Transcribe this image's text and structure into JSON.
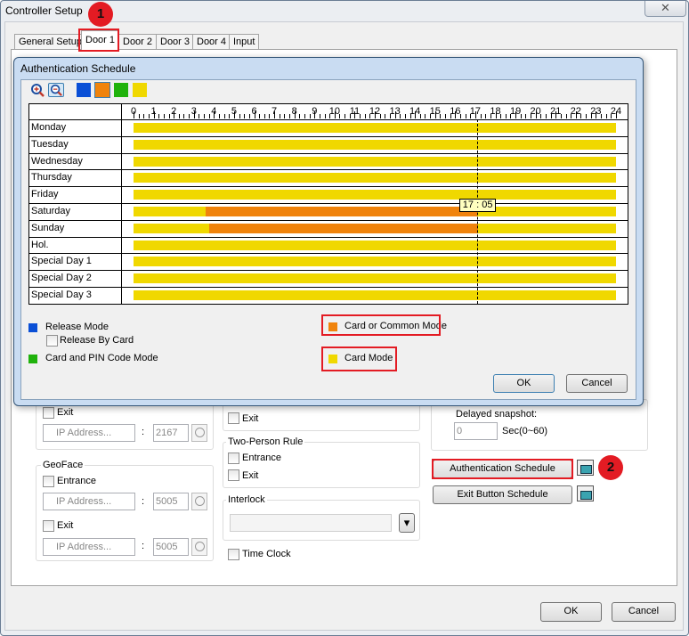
{
  "window": {
    "title": "Controller Setup",
    "close": "✕"
  },
  "tabs": [
    "General Setup",
    "Door 1",
    "Door 2",
    "Door 3",
    "Door 4",
    "Input"
  ],
  "annotations": {
    "badge1": "1",
    "badge2": "2"
  },
  "background": {
    "exit1_label": "Exit",
    "ip_placeholder": "IP Address...",
    "colon": ":",
    "port1": "2167",
    "geoface": {
      "title": "GeoFace",
      "entrance": "Entrance",
      "ip1": "IP Address...",
      "port1": "5005",
      "exit": "Exit",
      "ip2": "IP Address...",
      "port2": "5005"
    },
    "middle_exit": "Exit",
    "two_person": {
      "title": "Two-Person Rule",
      "entrance": "Entrance",
      "exit": "Exit"
    },
    "interlock": {
      "title": "Interlock",
      "dropdown_arrow": "▾"
    },
    "time_clock": "Time Clock",
    "delayed_snapshot": {
      "label": "Delayed snapshot:",
      "value": "0",
      "unit": "Sec(0~60)"
    },
    "auth_schedule_button": "Authentication Schedule",
    "exit_schedule_button": "Exit Button Schedule"
  },
  "footer": {
    "ok": "OK",
    "cancel": "Cancel"
  },
  "dialog": {
    "title": "Authentication Schedule",
    "toolbar_icons": [
      "zoom-in-icon",
      "zoom-out-icon"
    ],
    "palette": [
      "#0a4fd6",
      "#f0830c",
      "#20b20c",
      "#f0d800"
    ],
    "hours": [
      "0",
      "1",
      "2",
      "3",
      "4",
      "5",
      "6",
      "7",
      "8",
      "9",
      "10",
      "11",
      "12",
      "13",
      "14",
      "15",
      "16",
      "17",
      "18",
      "19",
      "20",
      "21",
      "22",
      "23",
      "24"
    ],
    "days": [
      {
        "label": "Monday",
        "segments": [
          {
            "from": 0,
            "to": 24,
            "color": "#f0d800"
          }
        ]
      },
      {
        "label": "Tuesday",
        "segments": [
          {
            "from": 0,
            "to": 24,
            "color": "#f0d800"
          }
        ]
      },
      {
        "label": "Wednesday",
        "segments": [
          {
            "from": 0,
            "to": 24,
            "color": "#f0d800"
          }
        ]
      },
      {
        "label": "Thursday",
        "segments": [
          {
            "from": 0,
            "to": 24,
            "color": "#f0d800"
          }
        ]
      },
      {
        "label": "Friday",
        "segments": [
          {
            "from": 0,
            "to": 24,
            "color": "#f0d800"
          }
        ]
      },
      {
        "label": "Saturday",
        "segments": [
          {
            "from": 0,
            "to": 3.6,
            "color": "#f0d800"
          },
          {
            "from": 3.6,
            "to": 17.08,
            "color": "#f0830c"
          },
          {
            "from": 17.08,
            "to": 24,
            "color": "#f0d800"
          }
        ]
      },
      {
        "label": "Sunday",
        "segments": [
          {
            "from": 0,
            "to": 3.75,
            "color": "#f0d800"
          },
          {
            "from": 3.75,
            "to": 17.15,
            "color": "#f0830c"
          },
          {
            "from": 17.15,
            "to": 24,
            "color": "#f0d800"
          }
        ]
      },
      {
        "label": "Hol.",
        "segments": [
          {
            "from": 0,
            "to": 24,
            "color": "#f0d800"
          }
        ]
      },
      {
        "label": "Special Day 1",
        "segments": [
          {
            "from": 0,
            "to": 24,
            "color": "#f0d800"
          }
        ]
      },
      {
        "label": "Special Day 2",
        "segments": [
          {
            "from": 0,
            "to": 24,
            "color": "#f0d800"
          }
        ]
      },
      {
        "label": "Special Day 3",
        "segments": [
          {
            "from": 0,
            "to": 24,
            "color": "#f0d800"
          }
        ]
      }
    ],
    "cursor_time": 17.0833,
    "cursor_label": "17 : 05",
    "legend": {
      "release_mode": "Release Mode",
      "release_by_card": "Release By Card",
      "card_pin": "Card and PIN Code Mode",
      "card_common": "Card or Common Mode",
      "card_mode": "Card Mode",
      "release_color": "#0a4fd6",
      "card_pin_color": "#20b20c",
      "card_common_color": "#f0830c",
      "card_mode_color": "#f0d800"
    },
    "ok": "OK",
    "cancel": "Cancel"
  }
}
